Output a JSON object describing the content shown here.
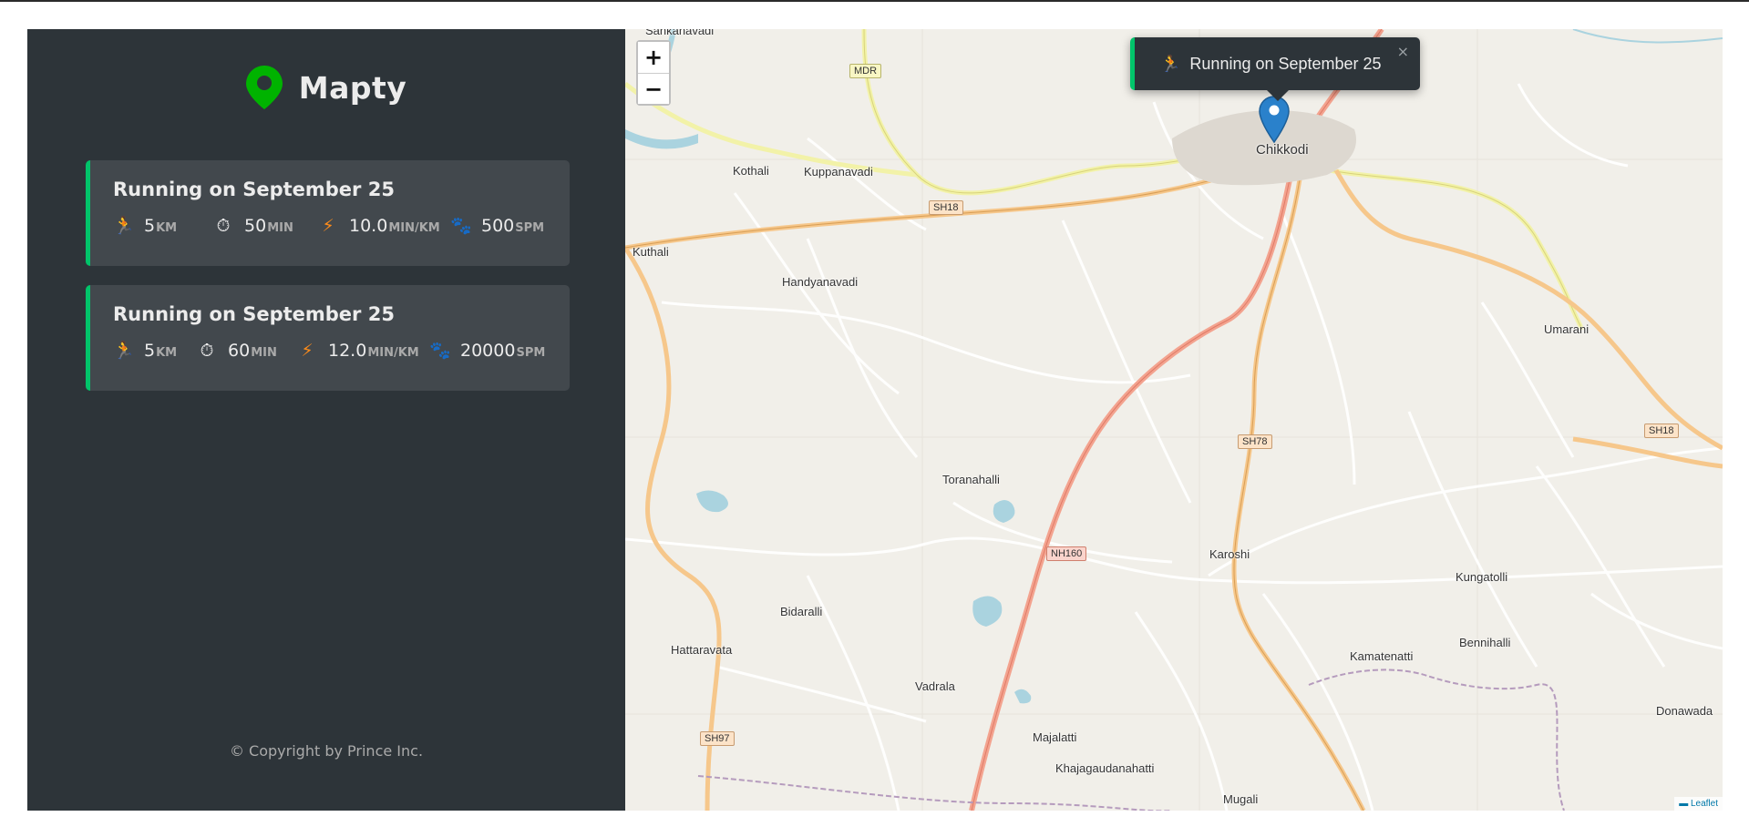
{
  "app": {
    "name": "Mapty",
    "brand_color": "#00c46a",
    "sidebar_bg": "#2d3439"
  },
  "workouts": [
    {
      "title": "Running on September 25",
      "type": "running",
      "distance": {
        "icon": "🏃",
        "value": "5",
        "unit": "km"
      },
      "duration": {
        "icon": "⏱",
        "value": "50",
        "unit": "min"
      },
      "pace": {
        "icon": "⚡",
        "value": "10.0",
        "unit": "min/km"
      },
      "cadence": {
        "icon": "🐾",
        "value": "500",
        "unit": "spm"
      }
    },
    {
      "title": "Running on September 25",
      "type": "running",
      "distance": {
        "icon": "🏃",
        "value": "5",
        "unit": "km"
      },
      "duration": {
        "icon": "⏱",
        "value": "60",
        "unit": "min"
      },
      "pace": {
        "icon": "⚡",
        "value": "12.0",
        "unit": "min/km"
      },
      "cadence": {
        "icon": "🐾",
        "value": "20000",
        "unit": "spm"
      }
    }
  ],
  "copyright": "© Copyright by Prince Inc.",
  "map": {
    "zoom_in": "+",
    "zoom_out": "−",
    "popup": {
      "icon": "🏃",
      "text": "Running on September 25",
      "close": "×"
    },
    "attribution": "Leaflet",
    "places": [
      "Sankanavadi",
      "Kothali",
      "Kuppanavadi",
      "Chikkodi",
      "Kuthali",
      "Handyanavadi",
      "Umarani",
      "Toranahalli",
      "Karoshi",
      "Kungatolli",
      "Bidaralli",
      "Hattaravata",
      "Kamatenatti",
      "Bennihalli",
      "Vadrala",
      "Donawada",
      "Majalatti",
      "Khajagaudanahatti",
      "Mugali"
    ],
    "shields": [
      "MDR",
      "SH18",
      "SH78",
      "SH18",
      "NH160",
      "SH97"
    ]
  }
}
